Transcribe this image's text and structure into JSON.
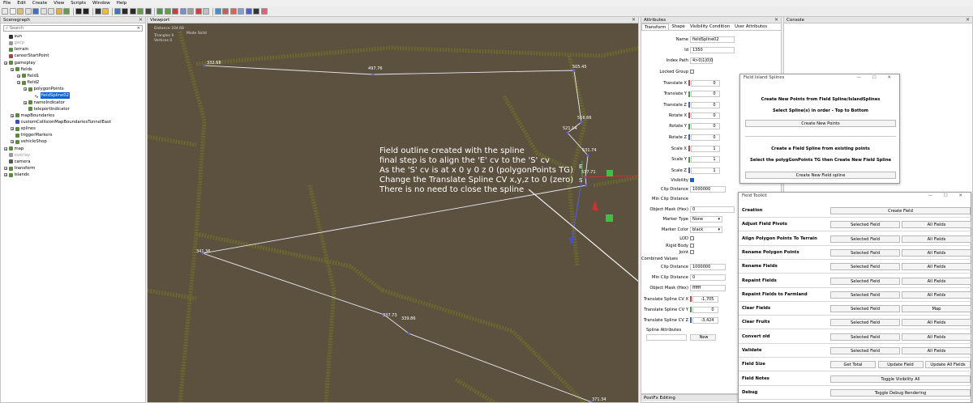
{
  "menu": [
    "File",
    "Edit",
    "Create",
    "View",
    "Scripts",
    "Window",
    "Help"
  ],
  "scenegraph": {
    "title": "Scenegraph",
    "search_placeholder": "Search",
    "items": [
      {
        "label": "sun",
        "depth": 0,
        "color": "#333"
      },
      {
        "label": "gscp",
        "depth": 0,
        "color": "#999",
        "muted": true
      },
      {
        "label": "terrain",
        "depth": 0,
        "color": "#5a8a3a"
      },
      {
        "label": "careerStartPoint",
        "depth": 0,
        "color": "#b04040"
      },
      {
        "label": "gameplay",
        "depth": 0,
        "color": "#5a8a3a",
        "expand": true
      },
      {
        "label": "fields",
        "depth": 1,
        "color": "#5a8a3a",
        "expand": true
      },
      {
        "label": "field1",
        "depth": 2,
        "color": "#5a8a3a",
        "expand": true
      },
      {
        "label": "field2",
        "depth": 2,
        "color": "#5a8a3a",
        "expand": true
      },
      {
        "label": "polygonPoints",
        "depth": 3,
        "color": "#5a8a3a",
        "expand": true
      },
      {
        "label": "fieldSpline02",
        "depth": 4,
        "color": "#222",
        "selected": true
      },
      {
        "label": "nameIndicator",
        "depth": 3,
        "color": "#5a8a3a",
        "expand": true
      },
      {
        "label": "teleportIndicator",
        "depth": 3,
        "color": "#5a8a3a"
      },
      {
        "label": "mapBoundaries",
        "depth": 1,
        "color": "#5a8a3a",
        "expand": true
      },
      {
        "label": "customCollisionMapBoundariesTunnelEast",
        "depth": 1,
        "color": "#3050c0"
      },
      {
        "label": "splines",
        "depth": 1,
        "color": "#5a8a3a",
        "expand": true
      },
      {
        "label": "triggerMarkers",
        "depth": 1,
        "color": "#5a8a3a"
      },
      {
        "label": "vehicleShop",
        "depth": 1,
        "color": "#5a8a3a",
        "expand": true
      },
      {
        "label": "map",
        "depth": 0,
        "color": "#5a8a3a",
        "expand": true
      },
      {
        "label": "overlay",
        "depth": 0,
        "color": "#999",
        "muted": true
      },
      {
        "label": "camera",
        "depth": 0,
        "color": "#555"
      },
      {
        "label": "transform",
        "depth": 0,
        "color": "#5a8a3a",
        "expand": true
      },
      {
        "label": "islands",
        "depth": 0,
        "color": "#5a8a3a",
        "expand": true
      }
    ]
  },
  "viewport": {
    "title": "Viewport",
    "info_lines": [
      "Distance 334.68",
      "Triangles       0",
      "Vertices         0"
    ],
    "mode_label": "Mode",
    "mode_value": "Solid",
    "annotation": [
      "Field outline created with the spline",
      "final step is to align the 'E' cv to the 'S' cv",
      "As the 'S' cv is at x 0 y 0 z 0 (polygonPoints TG)",
      "Change the Translate Spline CV x,y,z to 0 (zero)",
      "There is no need to close the spline"
    ],
    "vertex_labels": [
      "332.68",
      "497.76",
      "505.45",
      "516.66",
      "521.14",
      "531.74",
      "537.71",
      "E",
      "S",
      "341.36",
      "337.73",
      "339.86",
      "371.34"
    ]
  },
  "attributes": {
    "title": "Attributes",
    "tabs": [
      "Transform",
      "Shape",
      "Visibility Condition",
      "User Attributes"
    ],
    "name_label": "Name",
    "name_value": "fieldSpline02",
    "id_label": "Id",
    "id_value": "1350",
    "index_label": "Index Path",
    "index_value": "4>0|1|0|0",
    "locked_label": "Locked Group",
    "translate": [
      {
        "l": "Translate X",
        "v": "0"
      },
      {
        "l": "Translate Y",
        "v": "0"
      },
      {
        "l": "Translate Z",
        "v": "0"
      }
    ],
    "rotate": [
      {
        "l": "Rotate X",
        "v": "0"
      },
      {
        "l": "Rotate Y",
        "v": "0"
      },
      {
        "l": "Rotate Z",
        "v": "0"
      }
    ],
    "scale": [
      {
        "l": "Scale X",
        "v": "1"
      },
      {
        "l": "Scale Y",
        "v": "1"
      },
      {
        "l": "Scale Z",
        "v": "1"
      }
    ],
    "visibility_label": "Visibility",
    "clip_label": "Clip Distance",
    "clip_value": "1000000",
    "minclip_label": "Min Clip Distance",
    "minclip_value": "0",
    "mask_label": "Object Mask (Hex)",
    "mask_value": "0",
    "marker_type_label": "Marker Type",
    "marker_type_value": "None",
    "marker_color_label": "Marker Color",
    "marker_color_value": "black",
    "lod_label": "LOD",
    "rigid_label": "Rigid Body",
    "joint_label": "Joint",
    "combined_label": "Combined Values",
    "c_clip_label": "Clip Distance",
    "c_clip_value": "1000000",
    "c_minclip_label": "Min Clip Distance",
    "c_minclip_value": "0",
    "c_mask_label": "Object Mask (Hex)",
    "c_mask_value": "ffffff",
    "cv": [
      {
        "l": "Translate Spline CV X",
        "v": "-1,705"
      },
      {
        "l": "Translate Spline CV Y",
        "v": "0"
      },
      {
        "l": "Translate Spline CV Z",
        "v": "-3,424"
      }
    ],
    "spline_attr_label": "Spline Attributes",
    "new_label": "New",
    "bottom_title": "PostFx Editing"
  },
  "console": {
    "title": "Console"
  },
  "field_island": {
    "title": "Field Island Splines",
    "line1": "Create New Points from Field Spline/IslandSplines",
    "line2": "Select Spline(s) in order - Top to Bottom",
    "btn1": "Create New Points",
    "line3": "Create a Field Spline from existing points",
    "line4": "Select the polygGonPoints TG then Create New Field Spline",
    "btn2": "Create New Field spline"
  },
  "field_toolkit": {
    "title": "Field Toolkit",
    "rows": [
      {
        "label": "Creation",
        "buttons": [
          "Create Field"
        ]
      },
      {
        "label": "Adjust Field Pivots",
        "buttons": [
          "Selected Field",
          "All Fields"
        ]
      },
      {
        "label": "Align Polygon Points To Terrain",
        "buttons": [
          "Selected Field",
          "All Fields"
        ]
      },
      {
        "label": "Rename Polygon Points",
        "buttons": [
          "Selected Field",
          "All Fields"
        ]
      },
      {
        "label": "Rename Fields",
        "buttons": [
          "Selected Field",
          "All Fields"
        ]
      },
      {
        "label": "Repaint Fields",
        "buttons": [
          "Selected Field",
          "All Fields"
        ]
      },
      {
        "label": "Repaint Fields to Farmland",
        "buttons": [
          "Selected Field",
          "All Fields"
        ]
      },
      {
        "label": "Clear Fields",
        "buttons": [
          "Selected Field",
          "Map"
        ]
      },
      {
        "label": "Clear Fruits",
        "buttons": [
          "Selected Field",
          "All Fields"
        ]
      },
      {
        "label": "Convert old",
        "buttons": [
          "Selected Field",
          "All Fields"
        ]
      },
      {
        "label": "Validate",
        "buttons": [
          "Selected Field",
          "All Fields"
        ]
      },
      {
        "label": "Field Size",
        "buttons": [
          "Get Total",
          "Update Field",
          "Update All Fields"
        ]
      },
      {
        "label": "Field Notes",
        "buttons": [
          "Toggle Visibility All"
        ]
      },
      {
        "label": "Debug",
        "buttons": [
          "Toggle Debug Rendering"
        ]
      }
    ]
  },
  "win_controls": "—  ☐  ✕"
}
